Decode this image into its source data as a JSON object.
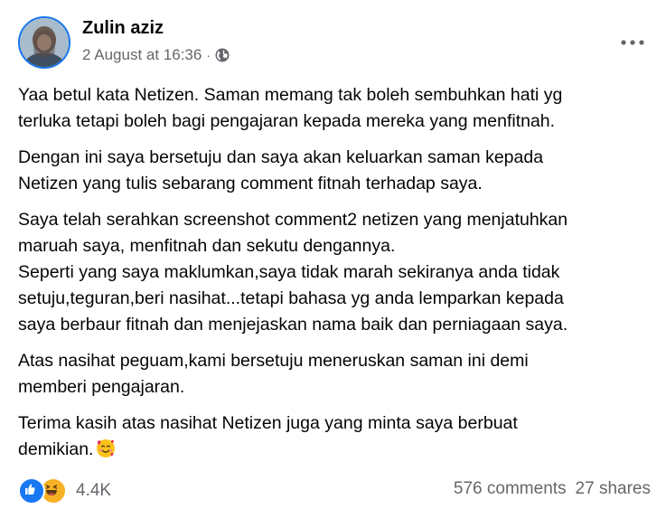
{
  "author": {
    "name": "Zulin aziz",
    "timestamp": "2 August at 16:36",
    "separator": "·",
    "audience_icon": "globe-icon"
  },
  "post": {
    "paragraphs": [
      {
        "lines": [
          "Yaa betul kata Netizen. Saman memang tak boleh sembuhkan hati yg",
          "terluka tetapi boleh bagi pengajaran kepada mereka yang menfitnah."
        ]
      },
      {
        "lines": [
          "Dengan ini saya bersetuju dan saya akan keluarkan saman kepada",
          "Netizen yang tulis sebarang comment fitnah terhadap saya."
        ]
      },
      {
        "lines": [
          "Saya telah serahkan screenshot comment2 netizen yang menjatuhkan",
          "maruah saya, menfitnah dan sekutu dengannya.",
          "Seperti yang saya maklumkan,saya tidak marah sekiranya anda tidak",
          "setuju,teguran,beri nasihat...tetapi bahasa yg anda lemparkan kepada",
          "saya berbaur fitnah dan menjejaskan nama baik dan perniagaan saya."
        ]
      },
      {
        "lines": [
          "Atas nasihat peguam,kami bersetuju meneruskan saman ini demi",
          "memberi pengajaran."
        ]
      },
      {
        "lines": [
          "Terima kasih atas nasihat Netizen juga yang minta saya berbuat",
          "demikian."
        ],
        "trailing_emoji": "smiling-face-with-hearts-emoji"
      }
    ]
  },
  "footer": {
    "reactions": [
      "like-icon",
      "haha-icon"
    ],
    "reaction_count": "4.4K",
    "comments": "576 comments",
    "shares": "27 shares"
  },
  "colors": {
    "text": "#050505",
    "secondary": "#65676b",
    "like_blue": "#1877f2",
    "haha_yellow": "#f7b125"
  }
}
